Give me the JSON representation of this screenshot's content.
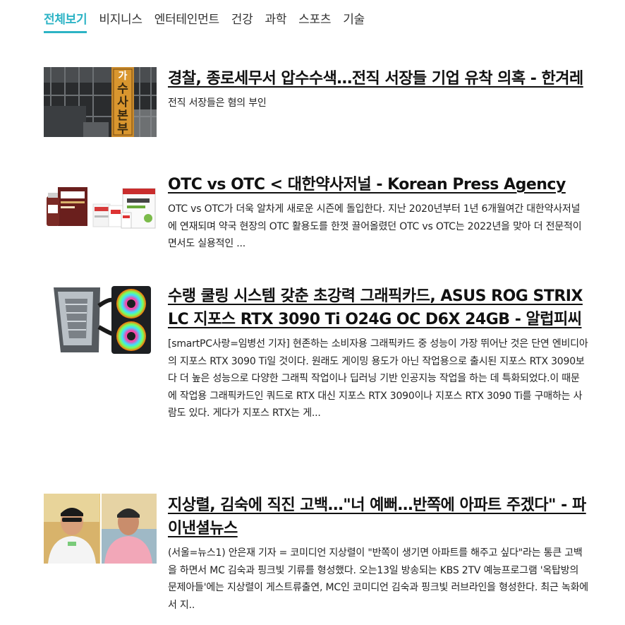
{
  "nav": {
    "tabs": [
      "전체보기",
      "비지니스",
      "엔터테인먼트",
      "건강",
      "과학",
      "스포츠",
      "기술"
    ],
    "active_index": 0
  },
  "articles": [
    {
      "title": "경찰, 종로세무서 압수수색…전직 서장들 기업 유착 의혹 - 한겨레",
      "description": "전직 서장들은 혐의 부인",
      "thumbnail_text": "수사본부",
      "thumbnail_top_text": "가"
    },
    {
      "title": "OTC vs OTC < 대한약사저널 - Korean Press Agency",
      "description": "OTC vs OTC가 더욱 알차게 새로운 시즌에 돌입한다. 지난 2020년부터 1년 6개월여간 대한약사저널에 연재되며 약국 현장의 OTC 활용도를 한껏 끌어올렸던 OTC vs OTC는 2022년을 맞아 더 전문적이면서도 실용적인 ..."
    },
    {
      "title": "수랭 쿨링 시스템 갖춘 초강력 그래픽카드, ASUS ROG STRIX LC 지포스 RTX 3090 Ti O24G OC D6X 24GB - 알럽피씨",
      "description": "[smartPC사랑=임병선 기자] 현존하는 소비자용 그래픽카드 중 성능이 가장 뛰어난 것은 단연 엔비디아의 지포스 RTX 3090 Ti일 것이다. 원래도 게이밍 용도가 아닌 작업용으로 출시된 지포스 RTX 3090보다 더 높은 성능으로 다양한 그래픽 작업이나 딥러닝 기반 인공지능 작업을 하는 데 특화되었다.이 때문에 작업용 그래픽카드인 쿼드로 RTX 대신 지포스 RTX 3090이나 지포스 RTX 3090 Ti를 구매하는 사람도 있다. 게다가 지포스 RTX는 게..."
    },
    {
      "title": "지상렬, 김숙에 직진 고백…\"너 예뻐…반쪽에 아파트 주겠다\" - 파이낸셜뉴스",
      "description": "(서울=뉴스1) 안은재 기자 = 코미디언 지상렬이 \"반쪽이 생기면 아파트를 해주고 싶다\"라는 통큰 고백을 하면서 MC 김숙과 핑크빛 기류를 형성했다. 오는13일 방송되는 KBS 2TV 예능프로그램 '옥탑방의 문제아들'에는 지상렬이 게스트류출연, MC인 코미디언 김숙과 핑크빛 러브라인을 형성한다. 최근 녹화에서 지.."
    }
  ]
}
